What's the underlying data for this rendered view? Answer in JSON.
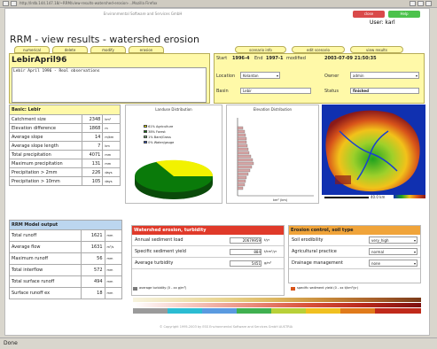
{
  "browser": {
    "url": "http://lrdb.144.147.18/~RRM/view-results-watershed-erosion-...Mozilla Firefox",
    "status": "Done"
  },
  "header": {
    "banner": "Environmental Software and Services GmbH",
    "close": "close",
    "help": "Help",
    "user": "User: karl"
  },
  "page": {
    "title": "RRM - view results - watershed erosion"
  },
  "tabs": [
    "numerical",
    "delete",
    "modify",
    "erosion"
  ],
  "actions": [
    "scenario info",
    "edit scenario",
    "view results"
  ],
  "scenario": {
    "name": "LebirApril96",
    "description": "Lebir April 1996 - Real observations"
  },
  "meta": {
    "start_label": "Start",
    "start": "1996-4",
    "end_label": "End",
    "end": "1997-1",
    "modified_label": "modified",
    "modified": "2003-07-09 21:50:35",
    "location_label": "Location",
    "location": "Kelantan",
    "owner_label": "Owner",
    "owner": "admin",
    "basin_label": "Basin",
    "basin": "Lebir",
    "status_label": "Status",
    "status": "finished"
  },
  "basic": {
    "title": "Basic: Lebir",
    "rows": [
      {
        "label": "Catchment size",
        "value": "2348",
        "unit": "km²"
      },
      {
        "label": "Elevation difference",
        "value": "1868",
        "unit": "m"
      },
      {
        "label": "Average slope",
        "value": "14",
        "unit": "m/km"
      },
      {
        "label": "Average slope length",
        "value": "7",
        "unit": "km"
      },
      {
        "label": "Total precipitation",
        "value": "4071",
        "unit": "mm"
      },
      {
        "label": "Maximum precipitation",
        "value": "131",
        "unit": "mm"
      },
      {
        "label": "Precipitation > 2mm",
        "value": "226",
        "unit": "days"
      },
      {
        "label": "Precipitation > 10mm",
        "value": "105",
        "unit": "days"
      }
    ]
  },
  "landuse": {
    "title": "Landuse Distribution",
    "legend": [
      {
        "label": "61% Agriculture",
        "color": "#f2f200",
        "value": 61
      },
      {
        "label": "38% Forest",
        "color": "#0a7a0a",
        "value": 38
      },
      {
        "label": "1% Bare/Grass",
        "color": "#7fbf7f",
        "value": 1
      },
      {
        "label": "0% Water/gauge",
        "color": "#2a56c6",
        "value": 0
      }
    ]
  },
  "elevation": {
    "title": "Elevation Distribution",
    "axis": "km² (km)"
  },
  "map": {
    "scale": "40.0 km"
  },
  "rrm": {
    "title": "RRM Model output",
    "rows": [
      {
        "label": "Total runoff",
        "value": "1621",
        "unit": "mm"
      },
      {
        "label": "Average flow",
        "value": "1631",
        "unit": "m³/s"
      },
      {
        "label": "Maximum runoff",
        "value": "56",
        "unit": "mm"
      },
      {
        "label": "Total interflow",
        "value": "572",
        "unit": "mm"
      },
      {
        "label": "Total surface runoff",
        "value": "494",
        "unit": "mm"
      },
      {
        "label": "Surface runoff ex",
        "value": "18",
        "unit": "mm"
      }
    ]
  },
  "erosion": {
    "title": "Watershed erosion, turbidity",
    "rows": [
      {
        "label": "Annual sediment load",
        "value": "20679959",
        "unit": "t/yr"
      },
      {
        "label": "Specific sediment yield",
        "value": "884",
        "unit": "t/km²/yr"
      },
      {
        "label": "Average turbidity",
        "value": "5451",
        "unit": "g/m³"
      }
    ],
    "legend1": "average turbidity  (0 - xx g/m³)",
    "legend2": "specific sediment yield  (0 - xx t/km²/yr)"
  },
  "control": {
    "title": "Erosion control, soil type",
    "rows": [
      {
        "label": "Soil erodibility",
        "value": "very_high"
      },
      {
        "label": "Agricultural practice",
        "value": "normal"
      },
      {
        "label": "Drainage management",
        "value": "none"
      }
    ]
  },
  "footer": "© Copyright 1995-2003 by   ESS   Environmental Software and Services GmbH AUSTRIA",
  "colors": {
    "yellow": "#fff9a8",
    "red": "#e03a2a",
    "orange": "#f0a43a"
  }
}
